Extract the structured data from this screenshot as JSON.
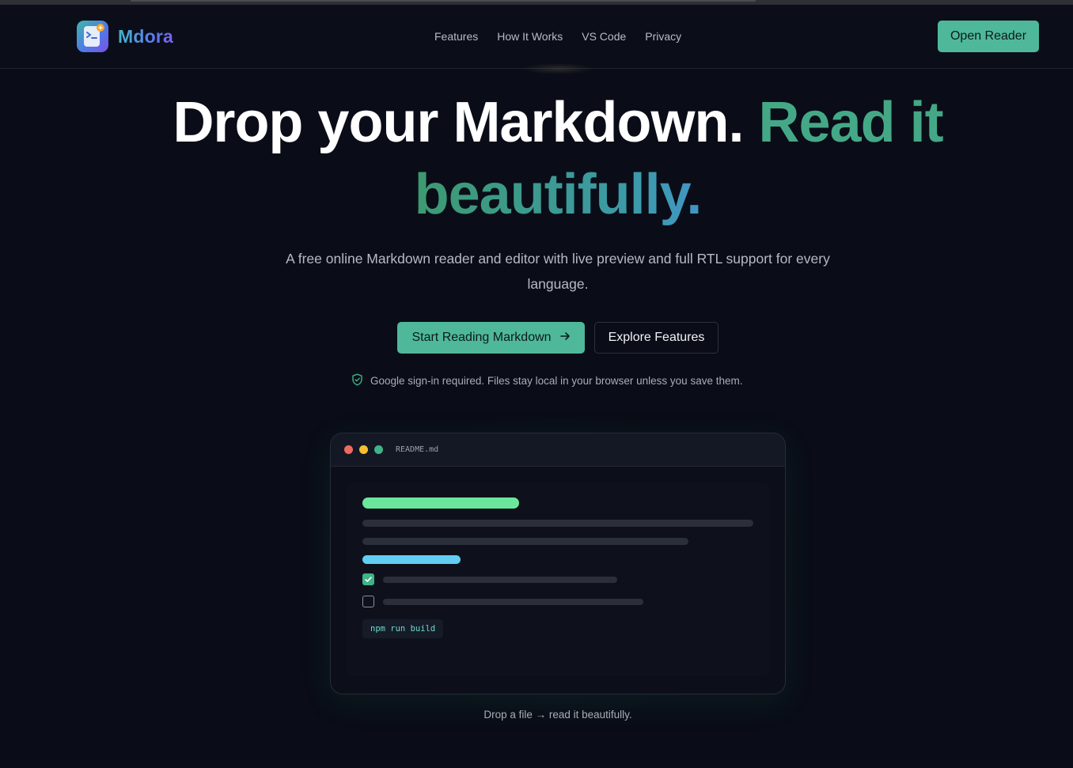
{
  "brand": {
    "name": "Mdora"
  },
  "nav": {
    "items": [
      "Features",
      "How It Works",
      "VS Code",
      "Privacy"
    ]
  },
  "header": {
    "open_reader_label": "Open Reader"
  },
  "hero": {
    "title_part1": "Drop your Markdown.",
    "title_part2": "Read it",
    "title_part3": "beautifully.",
    "subtitle": "A free online Markdown reader and editor with live preview and full RTL support for every language.",
    "primary_cta": "Start Reading Markdown",
    "secondary_cta": "Explore Features",
    "notice": "Google sign-in required. Files stay local in your browser unless you save them."
  },
  "preview": {
    "filename": "README.md",
    "code_snippet": "npm run build",
    "tasks": [
      {
        "checked": true
      },
      {
        "checked": false
      }
    ],
    "caption": "Drop a file → read it beautifully."
  },
  "colors": {
    "accent": "#4fb89b",
    "background": "#0a0d17",
    "heading_bar": "#6be79c",
    "link_bar": "#61cdf3"
  },
  "icons": [
    "logo-icon",
    "arrow-right-icon",
    "shield-check-icon",
    "checkbox-checked-icon",
    "checkbox-empty-icon"
  ]
}
